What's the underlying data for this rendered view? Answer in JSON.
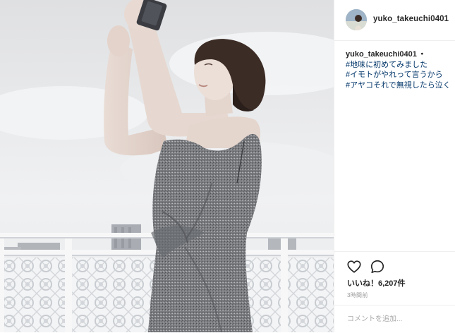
{
  "post": {
    "username": "yuko_takeuchi0401",
    "caption_user": "yuko_takeuchi0401",
    "caption_separator": "・",
    "hashtags": [
      "#地味に初めてみました",
      "#イモトがやれって言うから",
      "#アヤコそれで無視したら泣く"
    ],
    "likes_text": "いいね！6,207件",
    "timestamp": "3時間前",
    "comment_placeholder": "コメントを追加...",
    "icons": {
      "like": "heart-icon",
      "comment": "comment-bubble-icon"
    }
  }
}
